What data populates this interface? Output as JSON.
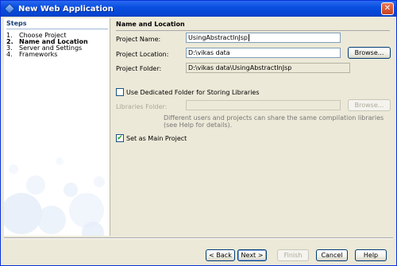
{
  "window": {
    "title": "New Web Application",
    "close_glyph": "✕"
  },
  "steps": {
    "header": "Steps",
    "items": [
      {
        "num": "1.",
        "label": "Choose Project"
      },
      {
        "num": "2.",
        "label": "Name and Location"
      },
      {
        "num": "3.",
        "label": "Server and Settings"
      },
      {
        "num": "4.",
        "label": "Frameworks"
      }
    ]
  },
  "main": {
    "section_title": "Name and Location",
    "project_name": {
      "label": "Project Name:",
      "value": "UsingAbstractInJsp"
    },
    "project_location": {
      "label": "Project Location:",
      "value": "D:\\vikas data",
      "browse_label": "Browse..."
    },
    "project_folder": {
      "label": "Project Folder:",
      "value": "D:\\vikas data\\UsingAbstractInJsp"
    },
    "dedicated_folder": {
      "label": "Use Dedicated Folder for Storing Libraries",
      "checked": false
    },
    "libraries_folder": {
      "label": "Libraries Folder:",
      "value": "",
      "browse_label": "Browse..."
    },
    "hint_lines": [
      "Different users and projects can share the same compilation libraries",
      "(see Help for details)."
    ],
    "main_project": {
      "label": "Set as Main Project",
      "checked": true,
      "check_glyph": "✔"
    }
  },
  "footer": {
    "back_label": "< Back",
    "next_label": "Next >",
    "finish_label": "Finish",
    "cancel_label": "Cancel",
    "help_label": "Help"
  }
}
